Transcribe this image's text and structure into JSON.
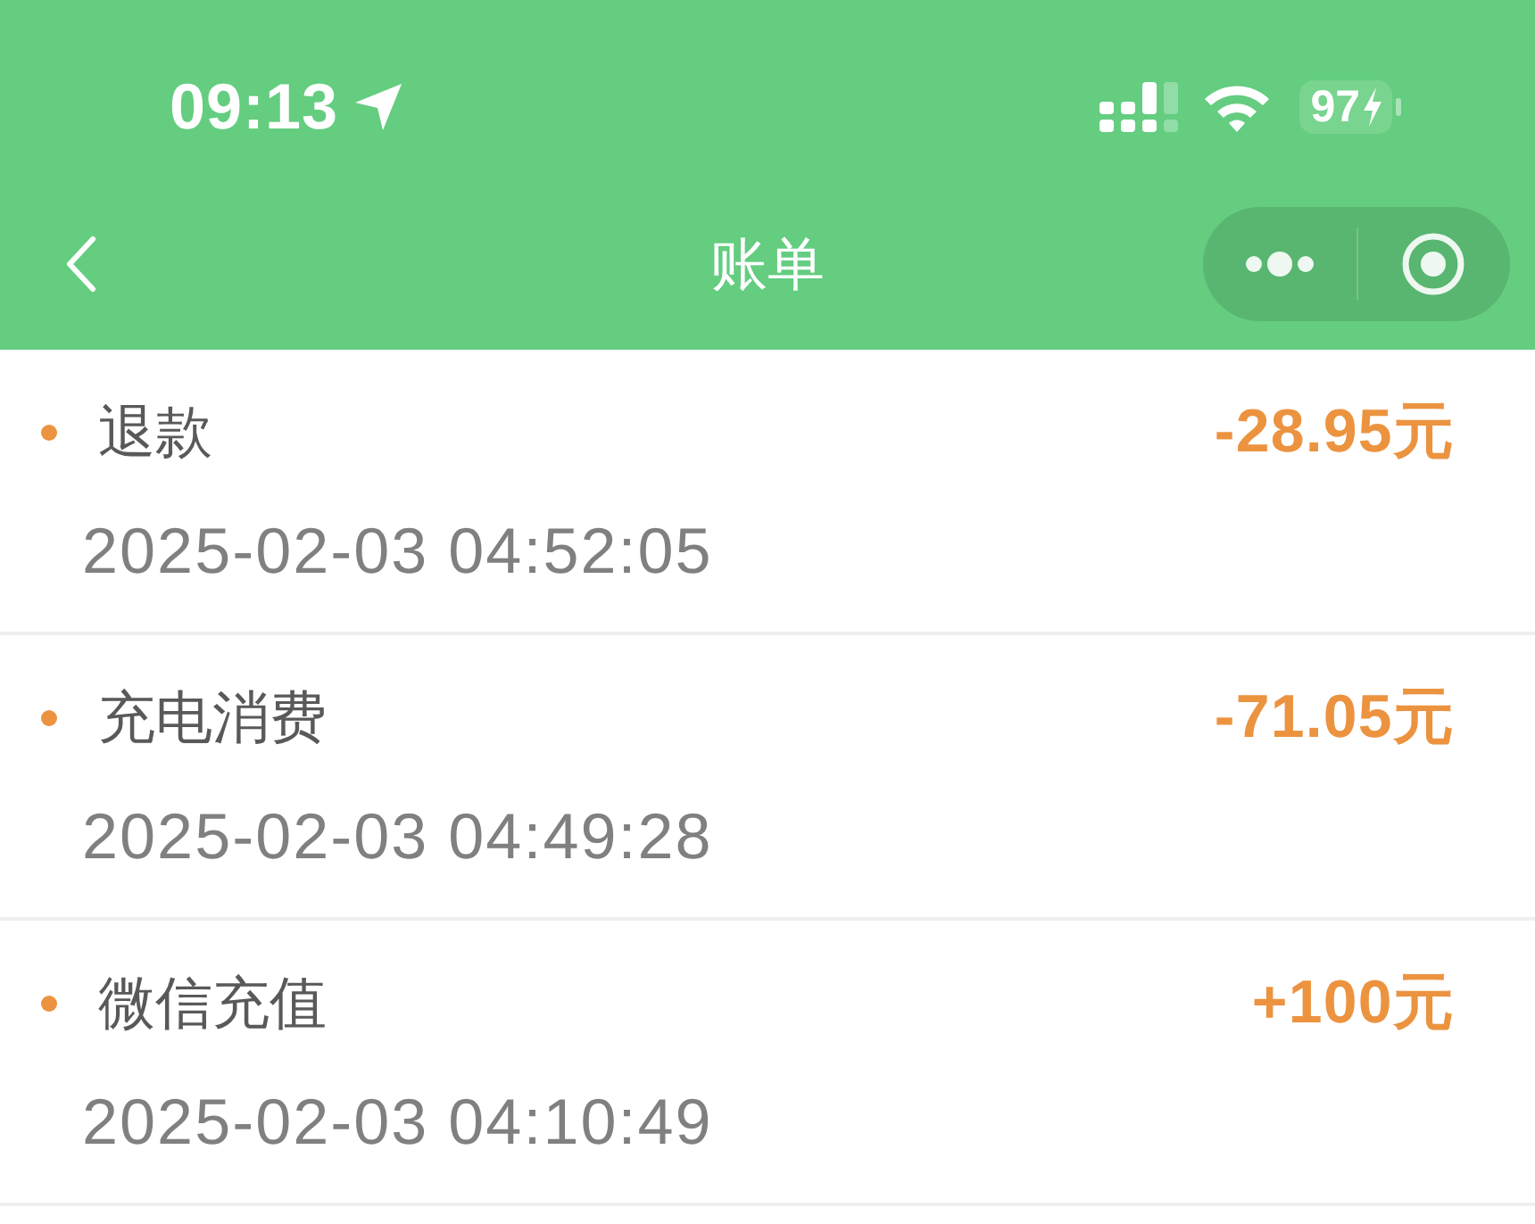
{
  "status_bar": {
    "time": "09:13",
    "battery": "97"
  },
  "nav_bar": {
    "title": "账单"
  },
  "bills": [
    {
      "title": "退款",
      "amount": "-28.95元",
      "time": "2025-02-03 04:52:05"
    },
    {
      "title": "充电消费",
      "amount": "-71.05元",
      "time": "2025-02-03 04:49:28"
    },
    {
      "title": "微信充值",
      "amount": "+100元",
      "time": "2025-02-03 04:10:49"
    }
  ]
}
